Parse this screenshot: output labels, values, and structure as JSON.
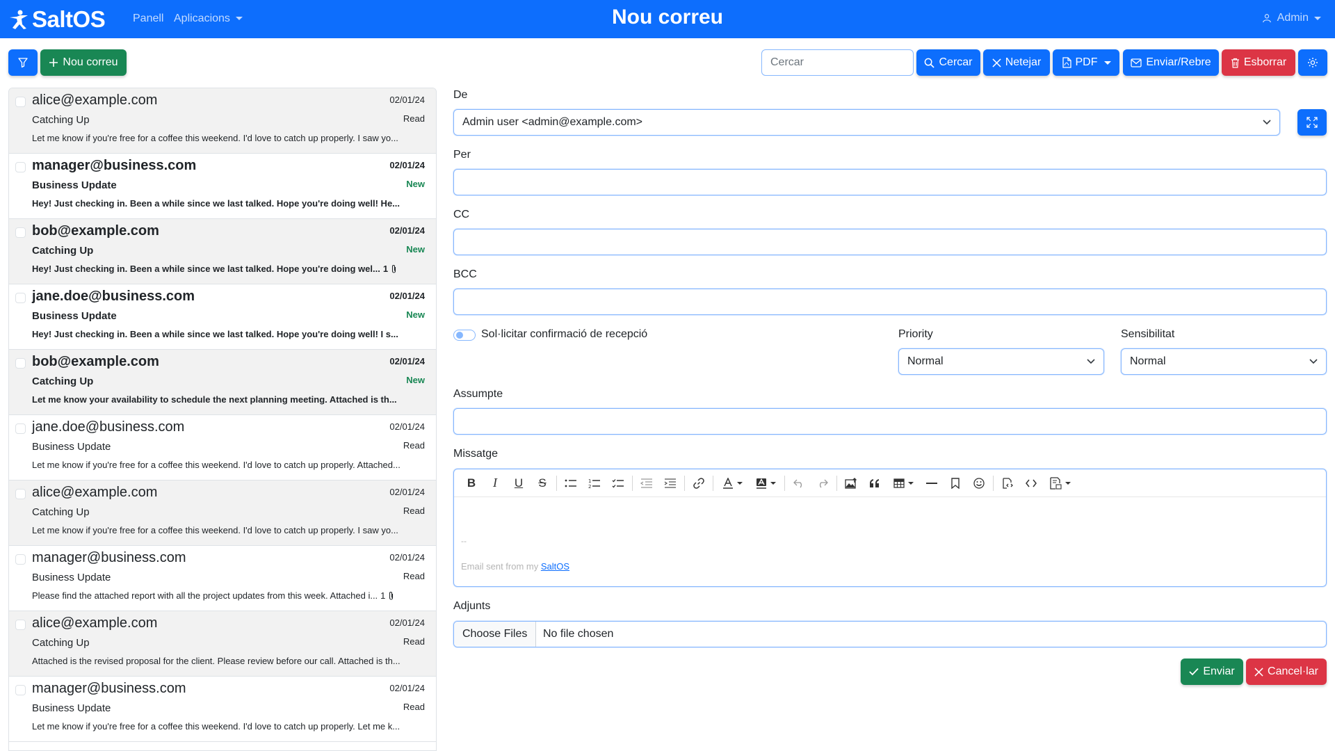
{
  "app": {
    "brand": "SaltOS",
    "page_title": "Nou correu",
    "nav": {
      "panel": "Panell",
      "apps": "Aplicacions",
      "user": "Admin"
    },
    "accent_color": "#0d6efd"
  },
  "toolbar": {
    "new_mail": "Nou correu",
    "search_placeholder": "Cercar",
    "search": "Cercar",
    "clear": "Netejar",
    "pdf": "PDF",
    "send_receive": "Enviar/Rebre",
    "delete": "Esborrar"
  },
  "mails": [
    {
      "from": "alice@example.com",
      "date": "02/01/24",
      "subject": "Catching Up",
      "status": "Read",
      "preview": "Let me know if you're free for a coffee this weekend. I'd love to catch up properly. I saw yo...",
      "attachments": ""
    },
    {
      "from": "manager@business.com",
      "date": "02/01/24",
      "subject": "Business Update",
      "status": "New",
      "preview": "Hey! Just checking in. Been a while since we last talked. Hope you're doing well! He...",
      "attachments": ""
    },
    {
      "from": "bob@example.com",
      "date": "02/01/24",
      "subject": "Catching Up",
      "status": "New",
      "preview": "Hey! Just checking in. Been a while since we last talked. Hope you're doing wel...",
      "attachments": "1"
    },
    {
      "from": "jane.doe@business.com",
      "date": "02/01/24",
      "subject": "Business Update",
      "status": "New",
      "preview": "Hey! Just checking in. Been a while since we last talked. Hope you're doing well! I s...",
      "attachments": ""
    },
    {
      "from": "bob@example.com",
      "date": "02/01/24",
      "subject": "Catching Up",
      "status": "New",
      "preview": "Let me know your availability to schedule the next planning meeting. Attached is th...",
      "attachments": ""
    },
    {
      "from": "jane.doe@business.com",
      "date": "02/01/24",
      "subject": "Business Update",
      "status": "Read",
      "preview": "Let me know if you're free for a coffee this weekend. I'd love to catch up properly. Attached...",
      "attachments": ""
    },
    {
      "from": "alice@example.com",
      "date": "02/01/24",
      "subject": "Catching Up",
      "status": "Read",
      "preview": "Let me know if you're free for a coffee this weekend. I'd love to catch up properly. I saw yo...",
      "attachments": ""
    },
    {
      "from": "manager@business.com",
      "date": "02/01/24",
      "subject": "Business Update",
      "status": "Read",
      "preview": "Please find the attached report with all the project updates from this week. Attached i...",
      "attachments": "1"
    },
    {
      "from": "alice@example.com",
      "date": "02/01/24",
      "subject": "Catching Up",
      "status": "Read",
      "preview": "Attached is the revised proposal for the client. Please review before our call. Attached is th...",
      "attachments": ""
    },
    {
      "from": "manager@business.com",
      "date": "02/01/24",
      "subject": "Business Update",
      "status": "Read",
      "preview": "Let me know if you're free for a coffee this weekend. I'd love to catch up properly. Let me k...",
      "attachments": ""
    }
  ],
  "form": {
    "from_label": "De",
    "from_value": "Admin user <admin@example.com>",
    "to_label": "Per",
    "cc_label": "CC",
    "bcc_label": "BCC",
    "receipt_label": "Sol·licitar confirmació de recepció",
    "priority_label": "Priority",
    "priority_value": "Normal",
    "sensitivity_label": "Sensibilitat",
    "sensitivity_value": "Normal",
    "subject_label": "Assumpte",
    "message_label": "Missatge",
    "signature_sep": "--",
    "signature_prefix": "Email sent from my ",
    "signature_link": "SaltOS",
    "attachments_label": "Adjunts",
    "file_button": "Choose Files",
    "file_status": "No file chosen",
    "send": "Enviar",
    "cancel": "Cancel·lar"
  }
}
